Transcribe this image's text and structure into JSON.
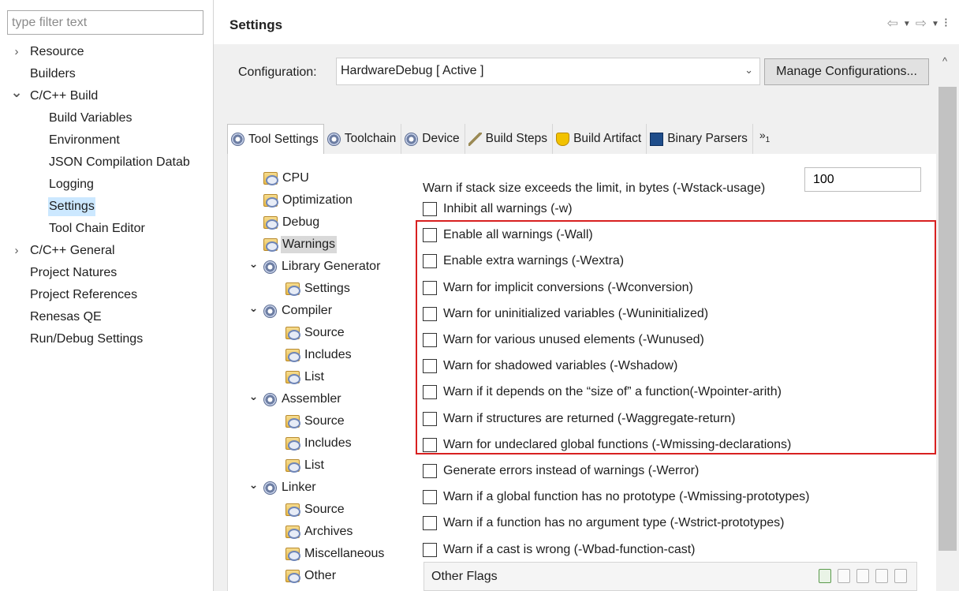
{
  "left": {
    "filter_placeholder": "type filter text",
    "tree": [
      {
        "label": "Resource",
        "level": 0,
        "twisty": "collapsed"
      },
      {
        "label": "Builders",
        "level": 0,
        "twisty": "none"
      },
      {
        "label": "C/C++ Build",
        "level": 0,
        "twisty": "expanded"
      },
      {
        "label": "Build Variables",
        "level": 1,
        "twisty": "none"
      },
      {
        "label": "Environment",
        "level": 1,
        "twisty": "none"
      },
      {
        "label": "JSON Compilation Datab",
        "level": 1,
        "twisty": "none"
      },
      {
        "label": "Logging",
        "level": 1,
        "twisty": "none"
      },
      {
        "label": "Settings",
        "level": 1,
        "twisty": "none",
        "selected": true
      },
      {
        "label": "Tool Chain Editor",
        "level": 1,
        "twisty": "none"
      },
      {
        "label": "C/C++ General",
        "level": 0,
        "twisty": "collapsed"
      },
      {
        "label": "Project Natures",
        "level": 0,
        "twisty": "none"
      },
      {
        "label": "Project References",
        "level": 0,
        "twisty": "none"
      },
      {
        "label": "Renesas QE",
        "level": 0,
        "twisty": "none"
      },
      {
        "label": "Run/Debug Settings",
        "level": 0,
        "twisty": "none"
      }
    ]
  },
  "header": {
    "title": "Settings",
    "tools": [
      "back-arrow-icon",
      "dropdown-icon",
      "forward-arrow-icon",
      "dropdown-icon",
      "more-vertical-icon"
    ]
  },
  "config": {
    "label": "Configuration:",
    "value": "HardwareDebug  [ Active ]",
    "manage_label": "Manage Configurations..."
  },
  "tabs": [
    {
      "label": "Tool Settings",
      "icon": "gear-icon",
      "active": true
    },
    {
      "label": "Toolchain",
      "icon": "gear-icon"
    },
    {
      "label": "Device",
      "icon": "gear-icon"
    },
    {
      "label": "Build Steps",
      "icon": "build-steps-icon"
    },
    {
      "label": "Build Artifact",
      "icon": "trophy-icon"
    },
    {
      "label": "Binary Parsers",
      "icon": "binary-icon"
    }
  ],
  "tab_more": {
    "label": "»",
    "count": "1"
  },
  "tool_tree": [
    {
      "label": "CPU",
      "indent": 1,
      "twisty": "none",
      "icon": "folder-settings-icon"
    },
    {
      "label": "Optimization",
      "indent": 1,
      "twisty": "none",
      "icon": "folder-settings-icon"
    },
    {
      "label": "Debug",
      "indent": 1,
      "twisty": "none",
      "icon": "folder-settings-icon"
    },
    {
      "label": "Warnings",
      "indent": 1,
      "twisty": "none",
      "icon": "folder-settings-icon",
      "selected": true
    },
    {
      "label": "Library Generator",
      "indent": 0,
      "twisty": "expanded",
      "icon": "gear-icon"
    },
    {
      "label": "Settings",
      "indent": 2,
      "twisty": "none",
      "icon": "folder-settings-icon"
    },
    {
      "label": "Compiler",
      "indent": 0,
      "twisty": "expanded",
      "icon": "gear-icon"
    },
    {
      "label": "Source",
      "indent": 2,
      "twisty": "none",
      "icon": "folder-settings-icon"
    },
    {
      "label": "Includes",
      "indent": 2,
      "twisty": "none",
      "icon": "folder-settings-icon"
    },
    {
      "label": "List",
      "indent": 2,
      "twisty": "none",
      "icon": "folder-settings-icon"
    },
    {
      "label": "Assembler",
      "indent": 0,
      "twisty": "expanded",
      "icon": "gear-icon"
    },
    {
      "label": "Source",
      "indent": 2,
      "twisty": "none",
      "icon": "folder-settings-icon"
    },
    {
      "label": "Includes",
      "indent": 2,
      "twisty": "none",
      "icon": "folder-settings-icon"
    },
    {
      "label": "List",
      "indent": 2,
      "twisty": "none",
      "icon": "folder-settings-icon"
    },
    {
      "label": "Linker",
      "indent": 0,
      "twisty": "expanded",
      "icon": "gear-icon"
    },
    {
      "label": "Source",
      "indent": 2,
      "twisty": "none",
      "icon": "folder-settings-icon"
    },
    {
      "label": "Archives",
      "indent": 2,
      "twisty": "none",
      "icon": "folder-settings-icon"
    },
    {
      "label": "Miscellaneous",
      "indent": 2,
      "twisty": "none",
      "icon": "folder-settings-icon"
    },
    {
      "label": "Other",
      "indent": 2,
      "twisty": "none",
      "icon": "folder-settings-icon"
    }
  ],
  "stack": {
    "label": "Warn if stack size exceeds the limit, in bytes (-Wstack-usage)",
    "value": "100"
  },
  "options": [
    {
      "label": "Inhibit all warnings (-w)",
      "checked": false
    },
    {
      "label": "Enable all warnings (-Wall)",
      "checked": false
    },
    {
      "label": "Enable extra warnings (-Wextra)",
      "checked": false
    },
    {
      "label": "Warn for implicit conversions (-Wconversion)",
      "checked": false
    },
    {
      "label": "Warn for uninitialized variables (-Wuninitialized)",
      "checked": false
    },
    {
      "label": "Warn for various unused elements (-Wunused)",
      "checked": false
    },
    {
      "label": "Warn for shadowed variables (-Wshadow)",
      "checked": false
    },
    {
      "label": "Warn if it depends on the “size of” a function(-Wpointer-arith)",
      "checked": false
    },
    {
      "label": "Warn if structures are returned (-Waggregate-return)",
      "checked": false
    },
    {
      "label": "Warn for undeclared global functions (-Wmissing-declarations)",
      "checked": false
    },
    {
      "label": "Generate errors instead of warnings (-Werror)",
      "checked": false
    },
    {
      "label": "Warn if a global function has no prototype (-Wmissing-prototypes)",
      "checked": false
    },
    {
      "label": "Warn if a function has no argument type (-Wstrict-prototypes)",
      "checked": false
    },
    {
      "label": "Warn if a cast is wrong (-Wbad-function-cast)",
      "checked": false
    }
  ],
  "other_flags": {
    "label": "Other Flags",
    "tools": [
      "add-icon",
      "delete-icon",
      "edit-icon",
      "move-up-icon",
      "move-down-icon"
    ]
  },
  "colors": {
    "highlight_border": "#d82020",
    "selection_blue": "#cce8ff",
    "panel_bg": "#f0f0f0"
  }
}
